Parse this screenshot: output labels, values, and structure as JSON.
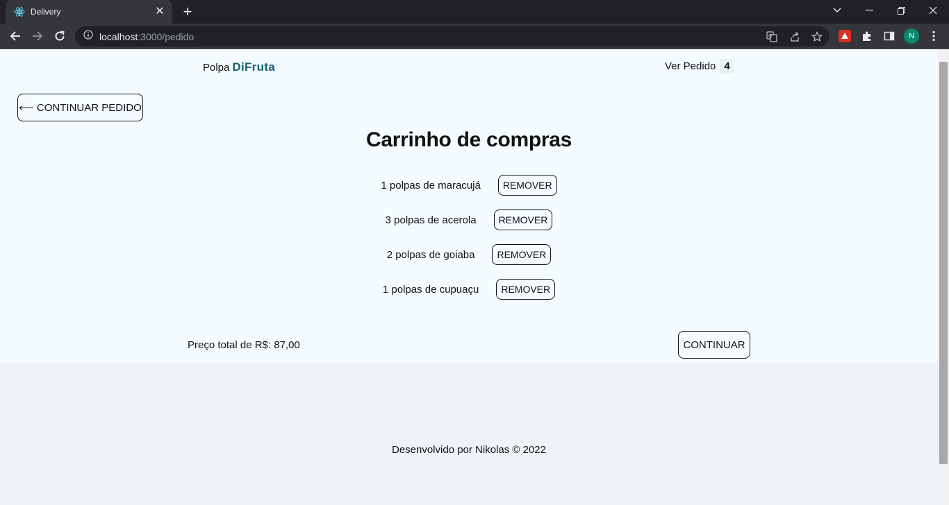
{
  "browser": {
    "tab_title": "Delivery",
    "url_host": "localhost",
    "url_path": ":3000/pedido",
    "profile_initial": "N"
  },
  "header": {
    "brand_prefix": "Polpa",
    "brand_name": "DiFruta",
    "ver_pedido_label": "Ver Pedido",
    "ver_pedido_count": "4"
  },
  "main": {
    "back_button_label": "⟵ CONTINUAR PEDIDO",
    "title": "Carrinho de compras",
    "items": [
      {
        "text": "1 polpas de maracujá",
        "remove_label": "REMOVER"
      },
      {
        "text": "3 polpas de acerola",
        "remove_label": "REMOVER"
      },
      {
        "text": "2 polpas de goiaba",
        "remove_label": "REMOVER"
      },
      {
        "text": "1 polpas de cupuaçu",
        "remove_label": "REMOVER"
      }
    ],
    "total_label": "Preço total de R$: 87,00",
    "continue_label": "CONTINUAR"
  },
  "footer": {
    "text": "Desenvolvido por Nikolas © 2022"
  },
  "colors": {
    "brand": "#165f73",
    "page_bg": "#f5fcff",
    "footer_bg": "#eef3f6"
  }
}
